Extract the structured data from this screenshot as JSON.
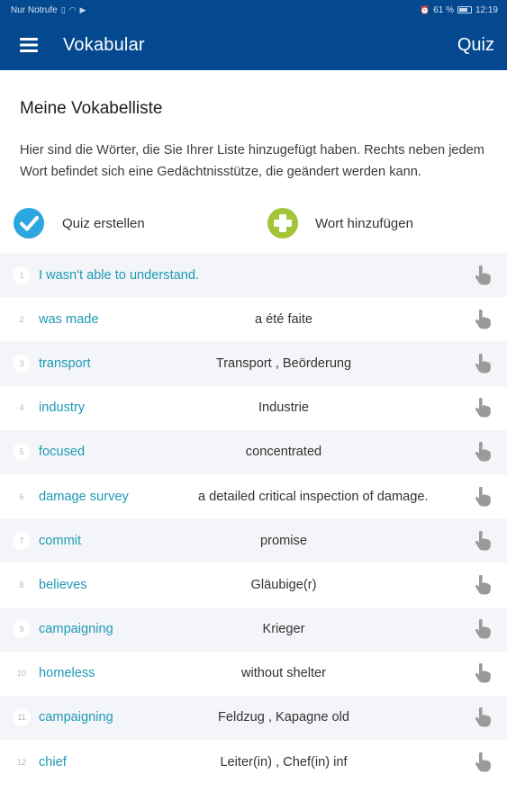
{
  "status": {
    "carrier": "Nur Notrufe",
    "battery": "61 %",
    "time": "12:19"
  },
  "appbar": {
    "title": "Vokabular",
    "quiz_label": "Quiz"
  },
  "page": {
    "title": "Meine Vokabelliste",
    "description": "Hier sind die Wörter, die Sie Ihrer Liste hinzugefügt haben. Rechts neben jedem Wort befindet sich eine Gedächtnisstütze, die geändert werden kann."
  },
  "actions": {
    "create_quiz": "Quiz erstellen",
    "add_word": "Wort hinzufügen"
  },
  "colors": {
    "primary": "#04498f",
    "check_icon": "#2ba6df",
    "plus_icon": "#a2c436",
    "word": "#1f9ab6"
  },
  "icons": {
    "menu": "menu-icon",
    "create_quiz": "checkmark-circle-icon",
    "add_word": "plus-circle-icon",
    "row_edit": "hand-pointer-icon"
  },
  "vocab": [
    {
      "num": "1",
      "word": "I wasn't able to understand.",
      "meaning": ""
    },
    {
      "num": "2",
      "word": "was made",
      "meaning": "a été faite"
    },
    {
      "num": "3",
      "word": "transport",
      "meaning": "Transport , Beörderung"
    },
    {
      "num": "4",
      "word": "industry",
      "meaning": "Industrie"
    },
    {
      "num": "5",
      "word": "focused",
      "meaning": "concentrated"
    },
    {
      "num": "6",
      "word": "damage survey",
      "meaning": "a detailed critical inspection of damage."
    },
    {
      "num": "7",
      "word": "commit",
      "meaning": "promise"
    },
    {
      "num": "8",
      "word": "believes",
      "meaning": "Gläubige(r)"
    },
    {
      "num": "9",
      "word": "campaigning",
      "meaning": "Krieger"
    },
    {
      "num": "10",
      "word": "homeless",
      "meaning": "without shelter"
    },
    {
      "num": "11",
      "word": "campaigning",
      "meaning": "Feldzug , Kapagne old"
    },
    {
      "num": "12",
      "word": "chief",
      "meaning": "Leiter(in) , Chef(in) inf"
    }
  ]
}
